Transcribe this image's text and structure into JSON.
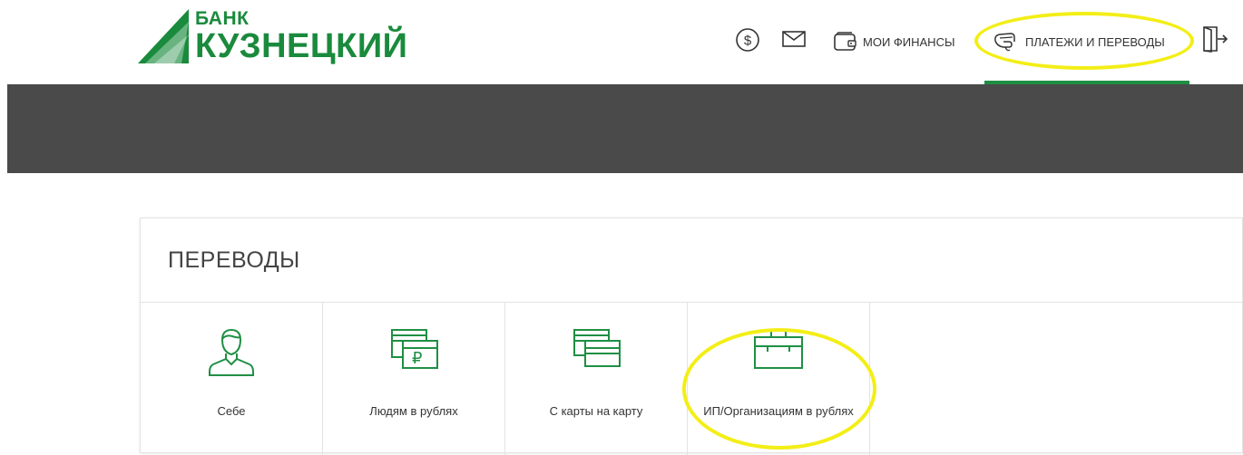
{
  "bank": {
    "name_top": "БАНК",
    "name_main": "КУЗНЕЦКИЙ",
    "brand_color": "#1a8a3c"
  },
  "nav": {
    "currency_icon": "dollar-circle-icon",
    "mail_icon": "envelope-icon",
    "my_finances_label": "МОИ ФИНАНСЫ",
    "payments_label": "ПЛАТЕЖИ И ПЕРЕВОДЫ",
    "logout_icon": "logout-door-icon",
    "active_item": "ПЛАТЕЖИ И ПЕРЕВОДЫ",
    "highlight_color": "#f3ee16"
  },
  "transfers": {
    "title": "ПЕРЕВОДЫ",
    "items": [
      {
        "label": "Себе",
        "icon": "person-icon"
      },
      {
        "label": "Людям в рублях",
        "icon": "ruble-cards-icon"
      },
      {
        "label": "С карты на карту",
        "icon": "cards-icon"
      },
      {
        "label": "ИП/Организациям в рублях",
        "icon": "briefcase-icon"
      }
    ]
  }
}
